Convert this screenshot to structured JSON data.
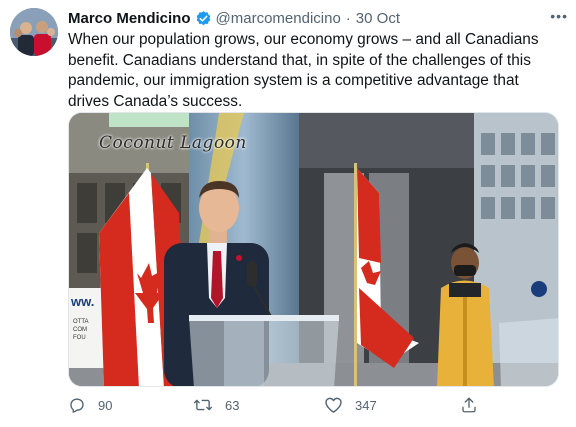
{
  "author": {
    "display_name": "Marco Mendicino",
    "handle": "@marcomendicino",
    "separator": "·",
    "date": "30 Oct",
    "verified": true
  },
  "more_label": "•••",
  "tweet_text": "When our population grows, our economy grows – and all Canadians benefit. Canadians understand that, in spite of the challenges of this pandemic, our immigration system is a competitive advantage that drives Canada’s success.",
  "media": {
    "watermark": "Coconut Lagoon",
    "sign_fragment": "ww.",
    "sign_lines": [
      "OTTA",
      "COM",
      "FOU"
    ]
  },
  "actions": {
    "replies": "90",
    "retweets": "63",
    "likes": "347"
  },
  "icons": {
    "reply": "reply-icon",
    "retweet": "retweet-icon",
    "like": "heart-icon",
    "share": "share-icon",
    "verified": "verified-badge-icon",
    "more": "more-options-icon"
  },
  "colors": {
    "text": "#0f1419",
    "secondary": "#536471",
    "verified": "#1d9bf0",
    "flag_red": "#d52b1e"
  }
}
